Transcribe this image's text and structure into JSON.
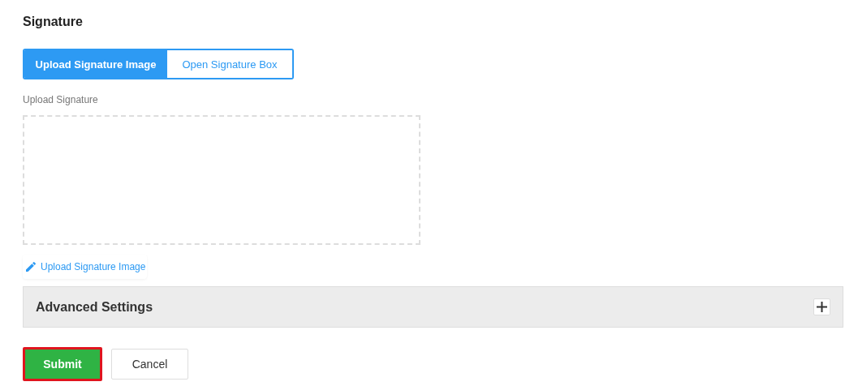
{
  "section_title": "Signature",
  "tabs": [
    {
      "label": "Upload Signature Image",
      "selected": true
    },
    {
      "label": "Open Signature Box",
      "selected": false
    }
  ],
  "upload": {
    "label": "Upload Signature",
    "link": "Upload Signature Image"
  },
  "advanced": {
    "title": "Advanced Settings",
    "expanded": false
  },
  "buttons": [
    {
      "label": "Submit",
      "kind": "primary",
      "highlighted": true
    },
    {
      "label": "Cancel",
      "kind": "secondary",
      "highlighted": false
    }
  ]
}
